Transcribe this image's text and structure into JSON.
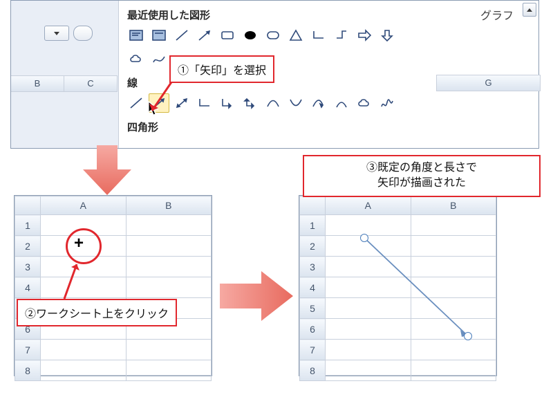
{
  "ribbon": {
    "tab": "グラフ"
  },
  "shapes": {
    "recent_title": "最近使用した図形",
    "lines_title": "線",
    "rect_title": "四角形",
    "top_cols": [
      "B",
      "C"
    ],
    "col_g": "G"
  },
  "callouts": {
    "c1": "①「矢印」を選択",
    "c2": "②ワークシート上をクリック",
    "c3": "③既定の角度と長さで\n矢印が描画された"
  },
  "sheet": {
    "cols": [
      "A",
      "B"
    ],
    "rows": [
      "1",
      "2",
      "3",
      "4",
      "5",
      "6",
      "7",
      "8"
    ],
    "plus": "+"
  }
}
